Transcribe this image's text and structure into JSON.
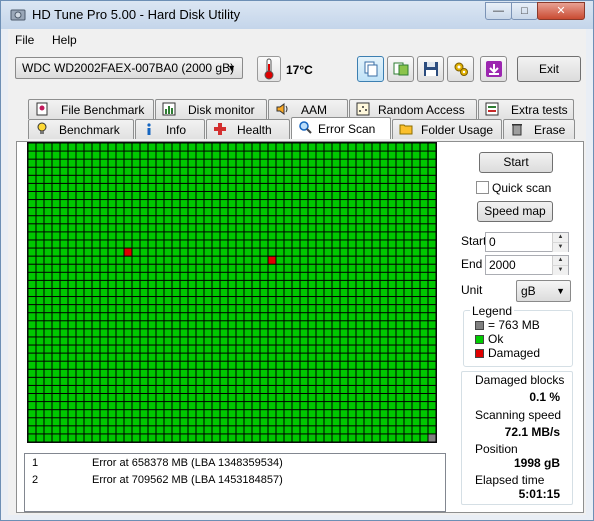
{
  "window": {
    "title": "HD Tune Pro 5.00 - Hard Disk Utility"
  },
  "menu": {
    "items": [
      "File",
      "Help"
    ]
  },
  "toolbar": {
    "drive": "WDC WD2002FAEX-007BA0 (2000 gB)",
    "temperature": "17°C",
    "exit_label": "Exit"
  },
  "tabs_top": [
    {
      "label": "File Benchmark",
      "icon": "file-benchmark-icon"
    },
    {
      "label": "Disk monitor",
      "icon": "disk-monitor-icon"
    },
    {
      "label": "AAM",
      "icon": "speaker-icon"
    },
    {
      "label": "Random Access",
      "icon": "random-access-icon"
    },
    {
      "label": "Extra tests",
      "icon": "extra-tests-icon"
    }
  ],
  "tabs_bottom": [
    {
      "label": "Benchmark",
      "icon": "lightbulb-icon"
    },
    {
      "label": "Info",
      "icon": "info-icon"
    },
    {
      "label": "Health",
      "icon": "health-cross-icon"
    },
    {
      "label": "Error Scan",
      "icon": "magnifier-icon",
      "active": true
    },
    {
      "label": "Folder Usage",
      "icon": "folder-icon"
    },
    {
      "label": "Erase",
      "icon": "trash-icon"
    }
  ],
  "scan": {
    "start_button": "Start",
    "quick_scan_label": "Quick scan",
    "quick_scan_checked": false,
    "speed_map_button": "Speed map",
    "start_label": "Start",
    "start_value": "0",
    "end_label": "End",
    "end_value": "2000",
    "unit_label": "Unit",
    "unit_value": "gB"
  },
  "legend": {
    "title": "Legend",
    "items": [
      {
        "label": "= 763 MB",
        "color": "#808080"
      },
      {
        "label": "Ok",
        "color": "#00cc00"
      },
      {
        "label": "Damaged",
        "color": "#e00000"
      }
    ]
  },
  "stats": {
    "damaged_blocks_label": "Damaged blocks",
    "damaged_blocks_value": "0.1 %",
    "scanning_speed_label": "Scanning speed",
    "scanning_speed_value": "72.1 MB/s",
    "position_label": "Position",
    "position_value": "1998 gB",
    "elapsed_label": "Elapsed time",
    "elapsed_value": "5:01:15"
  },
  "errors": [
    {
      "num": "1",
      "text": "Error at 658378 MB (LBA 1348359534)"
    },
    {
      "num": "2",
      "text": "Error at 709562 MB (LBA 1453184857)"
    }
  ],
  "block_map": {
    "columns": 51,
    "rows": 37,
    "ok_color": "#00c800",
    "damaged_color": "#e00000",
    "pending_color": "#808080",
    "damaged_cells": [
      [
        12,
        13
      ],
      [
        30,
        14
      ]
    ],
    "pending_cells": [
      [
        50,
        36
      ]
    ]
  }
}
